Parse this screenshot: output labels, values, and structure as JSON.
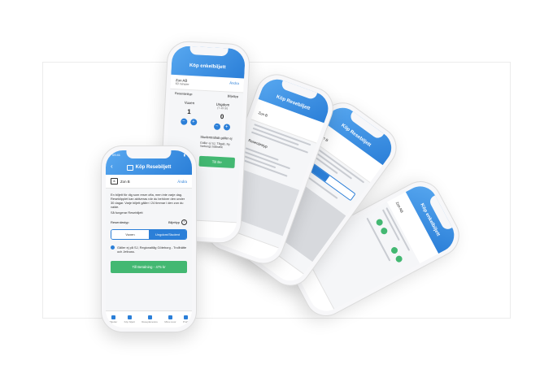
{
  "main": {
    "status_time": "09:41",
    "header_title": "Köp Resebiljett",
    "back": "‹",
    "zone_badge": "B",
    "zone_name": "Zon B",
    "zone_change": "Ändra",
    "description": "En biljett för dig som reser ofta, men inte varje dag. Reseklipplet kan aktiveras när du behöver den under 30 dagar. Varje biljett gäller i 24 timmar i den zon du valde.",
    "more_link": "Så fungerar Resebiljett",
    "traveler_label": "Resenärstyp",
    "help_label": "Biljettyp",
    "help_icon": "?",
    "segments": [
      "Vuxen",
      "Ungdom/Student"
    ],
    "selected_segment": 1,
    "info": "Gäller ej på SJ, Regionaltåg Göteborg - Trollhätte och Jetbuss.",
    "cta": "Till Betalning - 475 kr",
    "tabs": [
      "Biljetter",
      "Köp biljett",
      "Reseplanerare",
      "Mina resor",
      "Profil"
    ]
  },
  "phone_b": {
    "header_title": "Köp enkelbiljett",
    "zone_name": "Zon AB",
    "zone_sub": "60 minuter",
    "zone_change": "Ändra",
    "left_label": "Resenärstyp",
    "right_label": "Biljettyp",
    "col1_label": "Vuxen",
    "col1_value": "1",
    "col2_label": "Ungdom",
    "col2_sub": "(7-19 år)",
    "col2_value": "0",
    "note": "Studentrabatt gäller ej",
    "note2": "Gäller ej SJ, Tågab, Ny Varbergs båttrafik",
    "cta": "Till Be"
  },
  "phone_c": {
    "header_title": "Köp Resebiljett",
    "zone_name": "Zon B",
    "section": "Resenärstyp"
  },
  "phone_d": {
    "header_title": "Köp Resebiljett",
    "zone_name": "Zon B"
  },
  "phone_e": {
    "header_title": "Köp enkelbiljett",
    "zone_name": "Zon AB"
  },
  "colors": {
    "accent": "#2b7fd8",
    "cta_green": "#43b872"
  }
}
